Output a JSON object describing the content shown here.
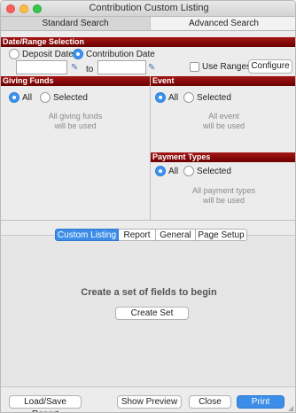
{
  "window": {
    "title": "Contribution Custom Listing",
    "traffic_lights": [
      "#fc605b",
      "#fdbc40",
      "#34c84a"
    ]
  },
  "top_tabs": {
    "standard": "Standard Search",
    "advanced": "Advanced Search"
  },
  "date_range": {
    "header": "Date/Range Selection",
    "deposit_label": "Deposit Date",
    "contribution_label": "Contribution Date",
    "from_value": "",
    "to_label": "to",
    "to_value": "",
    "use_ranges_label": "Use Ranges",
    "configure_label": "Configure"
  },
  "giving_funds": {
    "header": "Giving Funds",
    "all_label": "All",
    "selected_label": "Selected",
    "note_line1": "All giving funds",
    "note_line2": "will be used"
  },
  "event": {
    "header": "Event",
    "all_label": "All",
    "selected_label": "Selected",
    "note_line1": "All event",
    "note_line2": "will be used"
  },
  "payment_types": {
    "header": "Payment Types",
    "all_label": "All",
    "selected_label": "Selected",
    "note_line1": "All payment types",
    "note_line2": "will be used"
  },
  "lower_tabs": [
    "Custom Listing",
    "Report",
    "General",
    "Page Setup"
  ],
  "custom_listing": {
    "empty_message": "Create a set of fields to begin",
    "create_set_label": "Create Set"
  },
  "footer": {
    "load_save_label": "Load/Save Report",
    "show_preview_label": "Show Preview",
    "close_label": "Close",
    "print_label": "Print"
  },
  "colors": {
    "section_header": "#8b0000",
    "accent": "#3b8de8"
  }
}
